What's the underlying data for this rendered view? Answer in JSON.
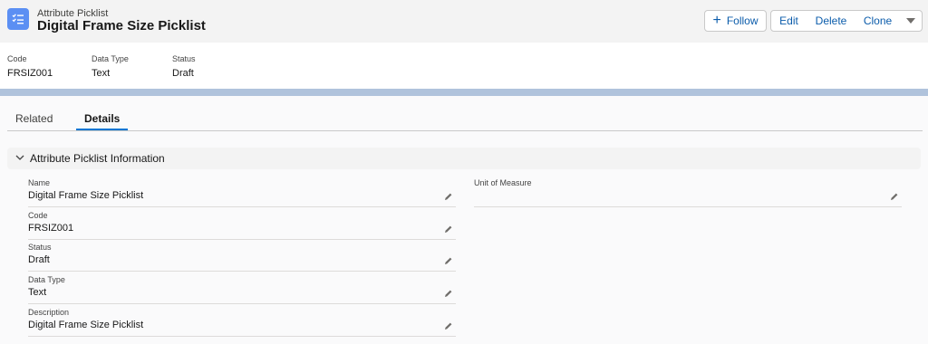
{
  "header": {
    "object_type": "Attribute Picklist",
    "record_name": "Digital Frame Size Picklist",
    "icon": "picklist-list-icon",
    "icon_color": "#5b8ff3"
  },
  "actions": {
    "follow": "Follow",
    "edit": "Edit",
    "delete": "Delete",
    "clone": "Clone",
    "more_icon": "chevron-down-icon"
  },
  "highlights": [
    {
      "label": "Code",
      "value": "FRSIZ001"
    },
    {
      "label": "Data Type",
      "value": "Text"
    },
    {
      "label": "Status",
      "value": "Draft"
    }
  ],
  "tabs": [
    {
      "label": "Related",
      "active": false
    },
    {
      "label": "Details",
      "active": true
    }
  ],
  "section": {
    "title": "Attribute Picklist Information",
    "left_fields": [
      {
        "label": "Name",
        "value": "Digital Frame Size Picklist"
      },
      {
        "label": "Code",
        "value": "FRSIZ001"
      },
      {
        "label": "Status",
        "value": "Draft"
      },
      {
        "label": "Data Type",
        "value": "Text"
      },
      {
        "label": "Description",
        "value": "Digital Frame Size Picklist"
      }
    ],
    "right_fields": [
      {
        "label": "Unit of Measure",
        "value": ""
      }
    ]
  },
  "colors": {
    "brand": "#0176d3",
    "link": "#0b5cab",
    "band": "#b0c3dc"
  }
}
